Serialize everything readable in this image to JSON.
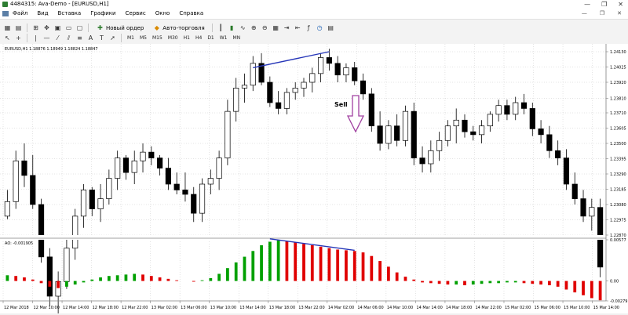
{
  "window": {
    "title": "4484315: Ava-Demo - [EURUSD,H1]",
    "controls": [
      "—",
      "❐",
      "✕"
    ]
  },
  "menu": {
    "items": [
      "Файл",
      "Вид",
      "Вставка",
      "Графики",
      "Сервис",
      "Окно",
      "Справка"
    ],
    "right_controls": [
      "—",
      "❐",
      "✕"
    ]
  },
  "toolbar": {
    "new_order_label": "Новый ордер",
    "autotrading_label": "Авто-торговля",
    "timeframes": [
      "M1",
      "M5",
      "M15",
      "M30",
      "H1",
      "H4",
      "D1",
      "W1",
      "MN"
    ]
  },
  "chart": {
    "header": "EURUSD,H1  1.18876 1.18949 1.18824 1.18847",
    "sell_label": "Sell",
    "price_ticks": [
      "1.24130",
      "1.24025",
      "1.23920",
      "1.23810",
      "1.23710",
      "1.23605",
      "1.23500",
      "1.23395",
      "1.23290",
      "1.23185",
      "1.23080",
      "1.22975",
      "1.22870"
    ],
    "ao_header": "AO: -0.001905",
    "ao_ticks": [
      "0.00577",
      "0.00",
      "-0.00279"
    ],
    "time_ticks": [
      "12 Mar 2018",
      "12 Mar 10:00",
      "12 Mar 14:00",
      "12 Mar 18:00",
      "12 Mar 22:00",
      "13 Mar 02:00",
      "13 Mar 06:00",
      "13 Mar 10:00",
      "13 Mar 14:00",
      "13 Mar 18:00",
      "13 Mar 22:00",
      "14 Mar 02:00",
      "14 Mar 06:00",
      "14 Mar 10:00",
      "14 Mar 14:00",
      "14 Mar 18:00",
      "14 Mar 22:00",
      "15 Mar 02:00",
      "15 Mar 06:00",
      "15 Mar 10:00",
      "15 Mar 14:00"
    ],
    "colors": {
      "bull": "#ffffff",
      "bear": "#000000",
      "ao_up": "#00a000",
      "ao_down": "#e00000",
      "trendline": "#2636b8",
      "sell_arrow": "#a040a0"
    }
  },
  "chart_data": {
    "type": "candlestick",
    "series": [
      {
        "name": "EURUSD,H1",
        "ohlc": [
          [
            1.23,
            1.2318,
            1.2298,
            1.231
          ],
          [
            1.231,
            1.2345,
            1.2305,
            1.2338
          ],
          [
            1.2338,
            1.235,
            1.232,
            1.2328
          ],
          [
            1.2328,
            1.2342,
            1.2305,
            1.2308
          ],
          [
            1.2308,
            1.2312,
            1.2268,
            1.2272
          ],
          [
            1.2272,
            1.2278,
            1.2238,
            1.2245
          ],
          [
            1.2245,
            1.2262,
            1.2232,
            1.2255
          ],
          [
            1.2255,
            1.2285,
            1.225,
            1.2278
          ],
          [
            1.2278,
            1.2305,
            1.227,
            1.23
          ],
          [
            1.23,
            1.2322,
            1.2292,
            1.2318
          ],
          [
            1.2318,
            1.232,
            1.23,
            1.2305
          ],
          [
            1.2305,
            1.2322,
            1.2296,
            1.2312
          ],
          [
            1.2312,
            1.2332,
            1.2308,
            1.2326
          ],
          [
            1.2326,
            1.2345,
            1.2318,
            1.234
          ],
          [
            1.234,
            1.2342,
            1.2325,
            1.233
          ],
          [
            1.233,
            1.2345,
            1.2322,
            1.2338
          ],
          [
            1.2338,
            1.235,
            1.233,
            1.2344
          ],
          [
            1.2344,
            1.2348,
            1.2335,
            1.234
          ],
          [
            1.234,
            1.2342,
            1.2328,
            1.2333
          ],
          [
            1.2333,
            1.234,
            1.2318,
            1.2322
          ],
          [
            1.2322,
            1.233,
            1.2315,
            1.2318
          ],
          [
            1.2318,
            1.233,
            1.231,
            1.2315
          ],
          [
            1.2315,
            1.232,
            1.2296,
            1.2302
          ],
          [
            1.2302,
            1.2326,
            1.2296,
            1.2322
          ],
          [
            1.2322,
            1.2332,
            1.2315,
            1.2326
          ],
          [
            1.2326,
            1.2345,
            1.2318,
            1.234
          ],
          [
            1.234,
            1.238,
            1.2335,
            1.2372
          ],
          [
            1.2372,
            1.2395,
            1.2365,
            1.2388
          ],
          [
            1.2388,
            1.2398,
            1.2378,
            1.239
          ],
          [
            1.239,
            1.241,
            1.2386,
            1.2405
          ],
          [
            1.2405,
            1.2412,
            1.239,
            1.2392
          ],
          [
            1.2392,
            1.2396,
            1.2375,
            1.2378
          ],
          [
            1.2378,
            1.2386,
            1.237,
            1.2374
          ],
          [
            1.2374,
            1.2388,
            1.237,
            1.2385
          ],
          [
            1.2385,
            1.2392,
            1.238,
            1.2388
          ],
          [
            1.2388,
            1.2395,
            1.2382,
            1.2392
          ],
          [
            1.2392,
            1.2402,
            1.2385,
            1.2398
          ],
          [
            1.2398,
            1.2412,
            1.2392,
            1.2409
          ],
          [
            1.2409,
            1.2415,
            1.24,
            1.2405
          ],
          [
            1.2405,
            1.241,
            1.2392,
            1.2397
          ],
          [
            1.2397,
            1.2405,
            1.2392,
            1.2402
          ],
          [
            1.2402,
            1.2406,
            1.239,
            1.2393
          ],
          [
            1.2393,
            1.2398,
            1.238,
            1.2384
          ],
          [
            1.2384,
            1.2388,
            1.2358,
            1.2362
          ],
          [
            1.2362,
            1.2372,
            1.2345,
            1.235
          ],
          [
            1.235,
            1.2366,
            1.2346,
            1.2362
          ],
          [
            1.2362,
            1.237,
            1.2348,
            1.2352
          ],
          [
            1.2352,
            1.2376,
            1.2348,
            1.2372
          ],
          [
            1.2372,
            1.2378,
            1.2335,
            1.234
          ],
          [
            1.234,
            1.2348,
            1.233,
            1.2336
          ],
          [
            1.2336,
            1.2352,
            1.233,
            1.2345
          ],
          [
            1.2345,
            1.2358,
            1.2338,
            1.2352
          ],
          [
            1.2352,
            1.2366,
            1.2348,
            1.2362
          ],
          [
            1.2362,
            1.2374,
            1.235,
            1.2366
          ],
          [
            1.2366,
            1.237,
            1.2354,
            1.2358
          ],
          [
            1.2358,
            1.2362,
            1.2352,
            1.2356
          ],
          [
            1.2356,
            1.2366,
            1.235,
            1.2362
          ],
          [
            1.2362,
            1.2372,
            1.2358,
            1.237
          ],
          [
            1.237,
            1.238,
            1.2365,
            1.2376
          ],
          [
            1.2376,
            1.238,
            1.2366,
            1.237
          ],
          [
            1.237,
            1.2382,
            1.2366,
            1.2378
          ],
          [
            1.2378,
            1.2384,
            1.237,
            1.2374
          ],
          [
            1.2374,
            1.2378,
            1.2355,
            1.236
          ],
          [
            1.236,
            1.2366,
            1.235,
            1.2356
          ],
          [
            1.2356,
            1.2362,
            1.234,
            1.2345
          ],
          [
            1.2345,
            1.2352,
            1.2335,
            1.234
          ],
          [
            1.234,
            1.2346,
            1.2318,
            1.2322
          ],
          [
            1.2322,
            1.233,
            1.2308,
            1.2312
          ],
          [
            1.2312,
            1.2318,
            1.2296,
            1.23
          ],
          [
            1.23,
            1.2312,
            1.229,
            1.2306
          ],
          [
            1.2306,
            1.2312,
            1.2258,
            1.2265
          ]
        ]
      },
      {
        "name": "AO",
        "values": [
          0.0008,
          0.0007,
          0.0005,
          0.0002,
          -0.0003,
          -0.0008,
          -0.001,
          -0.0008,
          -0.0005,
          -0.0002,
          0.0002,
          0.0005,
          0.0007,
          0.0008,
          0.0009,
          0.001,
          0.0009,
          0.0007,
          0.0005,
          0.0003,
          0.0001,
          0.0,
          -0.0001,
          0.0001,
          0.0004,
          0.001,
          0.0018,
          0.0026,
          0.0034,
          0.0042,
          0.005,
          0.0055,
          0.0057,
          0.0056,
          0.0054,
          0.0052,
          0.005,
          0.0048,
          0.0046,
          0.0044,
          0.0043,
          0.0042,
          0.004,
          0.0035,
          0.0028,
          0.002,
          0.0012,
          0.0006,
          0.0002,
          -0.0002,
          -0.0003,
          -0.0004,
          -0.0005,
          -0.0005,
          -0.0006,
          -0.0005,
          -0.0004,
          -0.0003,
          -0.0003,
          -0.0002,
          -0.0002,
          -0.0003,
          -0.0004,
          -0.0005,
          -0.0006,
          -0.0008,
          -0.0012,
          -0.0016,
          -0.002,
          -0.0024,
          -0.0027
        ]
      }
    ],
    "price_range": [
      1.2287,
      1.2413
    ],
    "ao_range": [
      -0.00279,
      0.00577
    ],
    "grid": true
  }
}
